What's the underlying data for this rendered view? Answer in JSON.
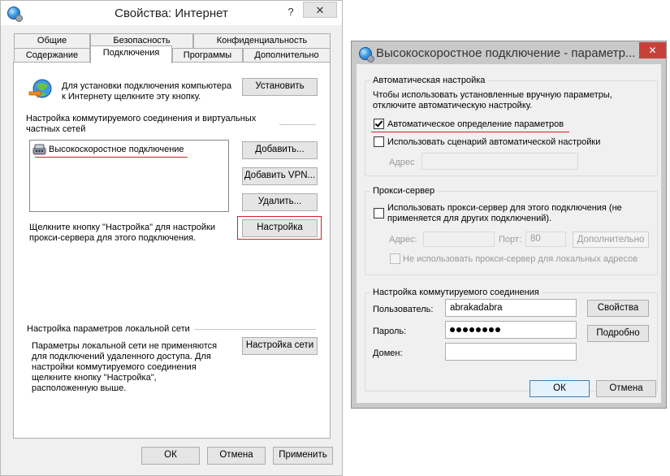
{
  "left_window": {
    "title": "Свойства: Интернет",
    "help_button": "?",
    "close_button": "✕",
    "tabs_row1": [
      "Общие",
      "Безопасность",
      "Конфиденциальность"
    ],
    "tabs_row2": [
      "Содержание",
      "Подключения",
      "Программы",
      "Дополнительно"
    ],
    "active_tab": "Подключения",
    "setup": {
      "text": "Для установки подключения компьютера\nк Интернету щелкните эту кнопку.",
      "button": "Установить"
    },
    "dialup_section": {
      "heading": "Настройка коммутируемого соединения и виртуальных\nчастных сетей",
      "connections": [
        "Высокоскоростное подключение"
      ],
      "add_button": "Добавить...",
      "add_vpn_button": "Добавить VPN...",
      "delete_button": "Удалить...",
      "settings_hint": "Щелкните кнопку \"Настройка\" для настройки\nпрокси-сервера для этого подключения.",
      "settings_button": "Настройка"
    },
    "lan_section": {
      "heading": "Настройка параметров локальной сети",
      "text": "Параметры локальной сети не применяются\nдля подключений удаленного доступа. Для\nнастройки коммутируемого соединения\nщелкните кнопку \"Настройка\",\nрасположенную выше.",
      "button": "Настройка сети"
    },
    "footer": {
      "ok": "ОК",
      "cancel": "Отмена",
      "apply": "Применить"
    }
  },
  "right_window": {
    "title": "Высокоскоростное подключение - параметр...",
    "close_button": "✕",
    "auto_config": {
      "group_label": "Автоматическая настройка",
      "description": "Чтобы использовать установленные вручную параметры,\nотключите автоматическую настройку.",
      "auto_detect_label": "Автоматическое определение параметров",
      "auto_detect_checked": true,
      "use_script_label": "Использовать сценарий автоматической настройки",
      "use_script_checked": false,
      "address_label": "Адрес",
      "address_value": ""
    },
    "proxy": {
      "group_label": "Прокси-сервер",
      "use_proxy_label": "Использовать прокси-сервер для этого подключения (не\nприменяется для других подключений).",
      "use_proxy_checked": false,
      "address_label": "Адрес:",
      "address_value": "",
      "port_label": "Порт:",
      "port_value": "80",
      "advanced_button": "Дополнительно",
      "bypass_local_label": "Не использовать прокси-сервер для локальных адресов",
      "bypass_local_checked": false
    },
    "dialup": {
      "group_label": "Настройка коммутируемого соединения",
      "user_label": "Пользователь:",
      "user_value": "abrakadabra",
      "password_label": "Пароль:",
      "password_dot_count": 8,
      "domain_label": "Домен:",
      "domain_value": "",
      "properties_button": "Свойства",
      "details_button": "Подробно"
    },
    "footer": {
      "ok": "ОК",
      "cancel": "Отмена"
    }
  },
  "colors": {
    "highlight": "#d21f2b",
    "window_bg": "#f0f0f0",
    "close_button_bg": "#c7413a"
  }
}
